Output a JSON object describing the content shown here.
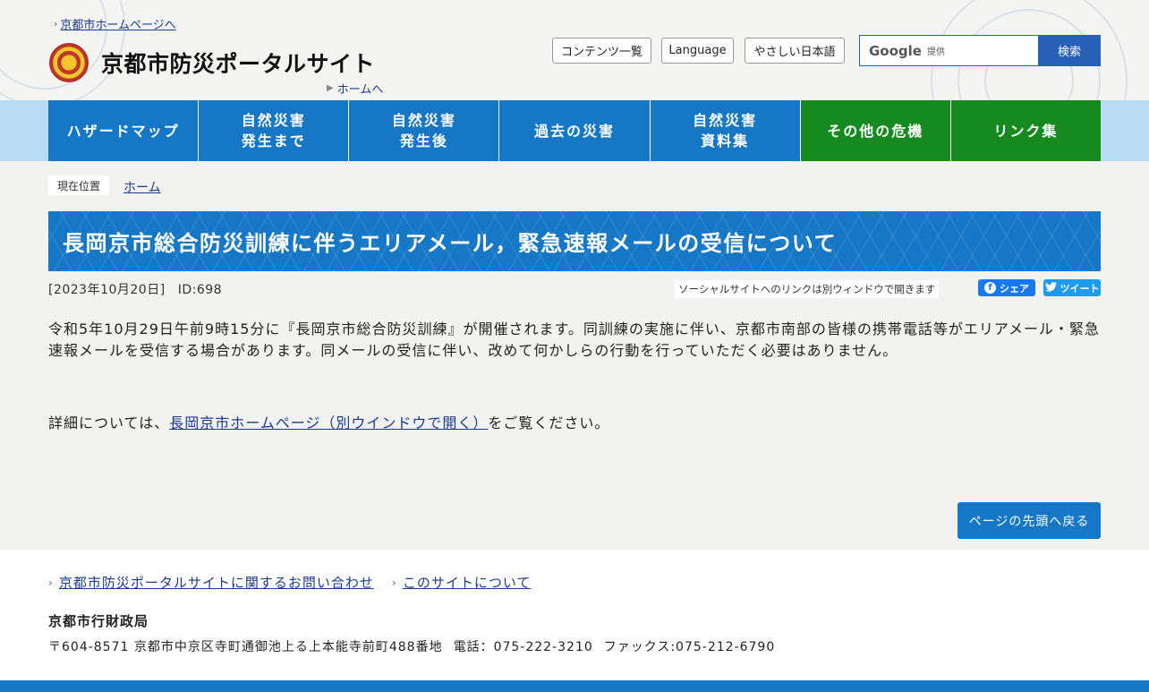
{
  "header": {
    "city_home_link": "京都市ホームページへ",
    "site_title": "京都市防災ポータルサイト",
    "home_link": "ホームへ",
    "util_buttons": [
      "コンテンツ一覧",
      "Language",
      "やさしい日本語"
    ],
    "search": {
      "brand": "Google",
      "brand_sub": "提供",
      "button": "検索"
    }
  },
  "nav": {
    "items": [
      {
        "label": "ハザードマップ",
        "color": "#1677c6"
      },
      {
        "label": "自然災害\n発生まで",
        "color": "#1677c6"
      },
      {
        "label": "自然災害\n発生後",
        "color": "#1677c6"
      },
      {
        "label": "過去の災害",
        "color": "#1677c6"
      },
      {
        "label": "自然災害\n資料集",
        "color": "#1677c6"
      },
      {
        "label": "その他の危機",
        "color": "#168a1f"
      },
      {
        "label": "リンク集",
        "color": "#168a1f"
      }
    ]
  },
  "breadcrumb": {
    "label": "現在位置",
    "home": "ホーム"
  },
  "article": {
    "title": "長岡京市総合防災訓練に伴うエリアメール，緊急速報メールの受信について",
    "date": "[2023年10月20日]",
    "id": "ID:698",
    "social_note": "ソーシャルサイトへのリンクは別ウィンドウで開きます",
    "share_facebook": "シェア",
    "share_twitter": "ツイート",
    "body": "令和5年10月29日午前9時15分に『長岡京市総合防災訓練』が開催されます。同訓練の実施に伴い、京都市南部の皆様の携帯電話等がエリアメール・緊急速報メールを受信する場合があります。同メールの受信に伴い、改めて何かしらの行動を行っていただく必要はありません。",
    "detail_prefix": "詳細については、",
    "detail_link": "長岡京市ホームページ（別ウインドウで開く）",
    "detail_suffix": "をご覧ください。",
    "back_to_top": "ページの先頭へ戻る"
  },
  "footer": {
    "links": [
      "京都市防災ポータルサイトに関するお問い合わせ",
      "このサイトについて"
    ],
    "office": "京都市行財政局",
    "address": "〒604-8571 京都市中京区寺町通御池上る上本能寺前町488番地",
    "phone": "電話：075-222-3210",
    "fax": "ファックス:075-212-6790"
  },
  "colors": {
    "primary_blue": "#1677c6",
    "green": "#168a1f",
    "light_band": "#b7dcf3"
  }
}
